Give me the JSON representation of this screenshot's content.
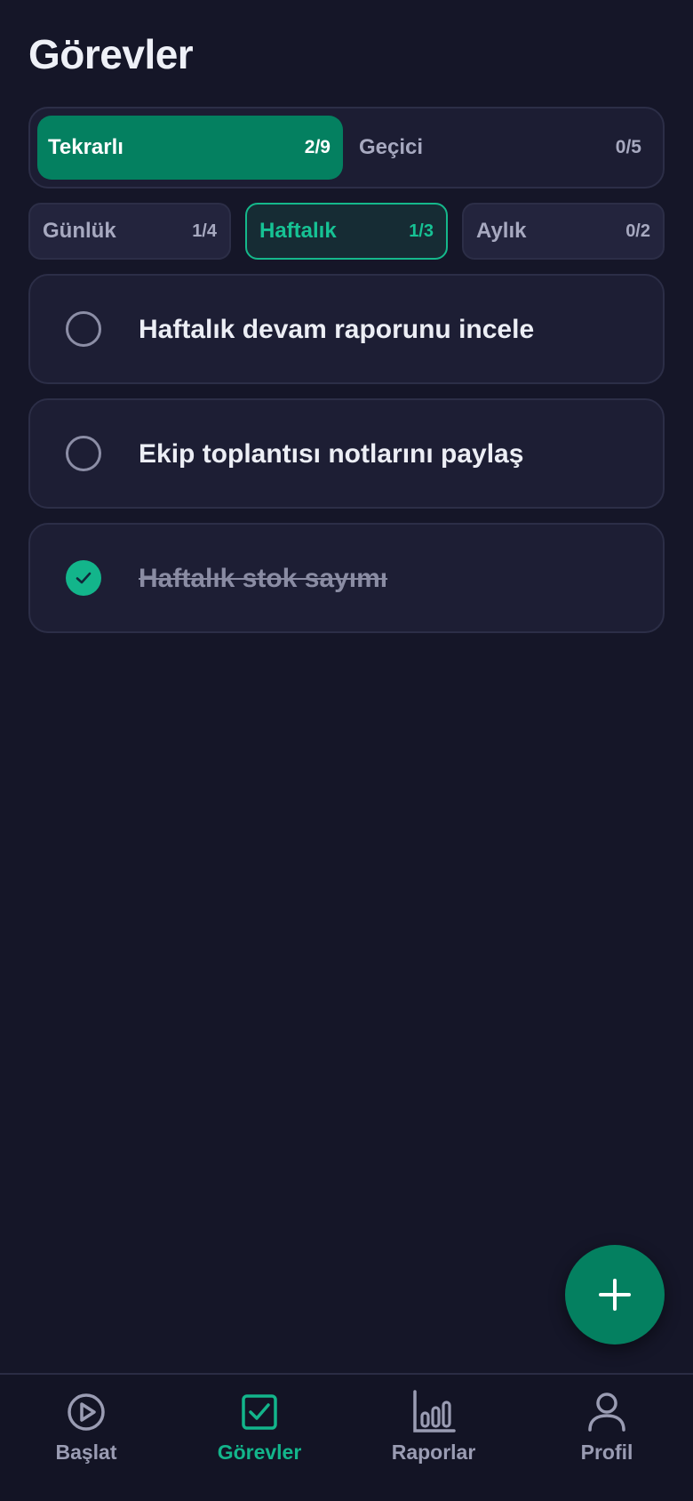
{
  "page": {
    "title": "Görevler"
  },
  "segment": {
    "left": {
      "label": "Tekrarlı",
      "count": "2/9",
      "active": true
    },
    "right": {
      "label": "Geçici",
      "count": "0/5",
      "active": false
    }
  },
  "periods": [
    {
      "label": "Günlük",
      "count": "1/4",
      "active": false
    },
    {
      "label": "Haftalık",
      "count": "1/3",
      "active": true
    },
    {
      "label": "Aylık",
      "count": "0/2",
      "active": false
    }
  ],
  "tasks": [
    {
      "text": "Haftalık devam raporunu incele",
      "done": false
    },
    {
      "text": "Ekip toplantısı notlarını paylaş",
      "done": false
    },
    {
      "text": "Haftalık stok sayımı",
      "done": true
    }
  ],
  "fab": {
    "icon": "plus-icon"
  },
  "nav": [
    {
      "label": "Başlat",
      "icon": "play-circle-icon",
      "active": false
    },
    {
      "label": "Görevler",
      "icon": "checkbox-icon",
      "active": true
    },
    {
      "label": "Raporlar",
      "icon": "bar-chart-icon",
      "active": false
    },
    {
      "label": "Profil",
      "icon": "person-icon",
      "active": false
    }
  ],
  "colors": {
    "background": "#151628",
    "accent": "#048060",
    "accent_bright": "#13b58b",
    "card": "#1d1e34",
    "muted_text": "#a7a9c0"
  }
}
